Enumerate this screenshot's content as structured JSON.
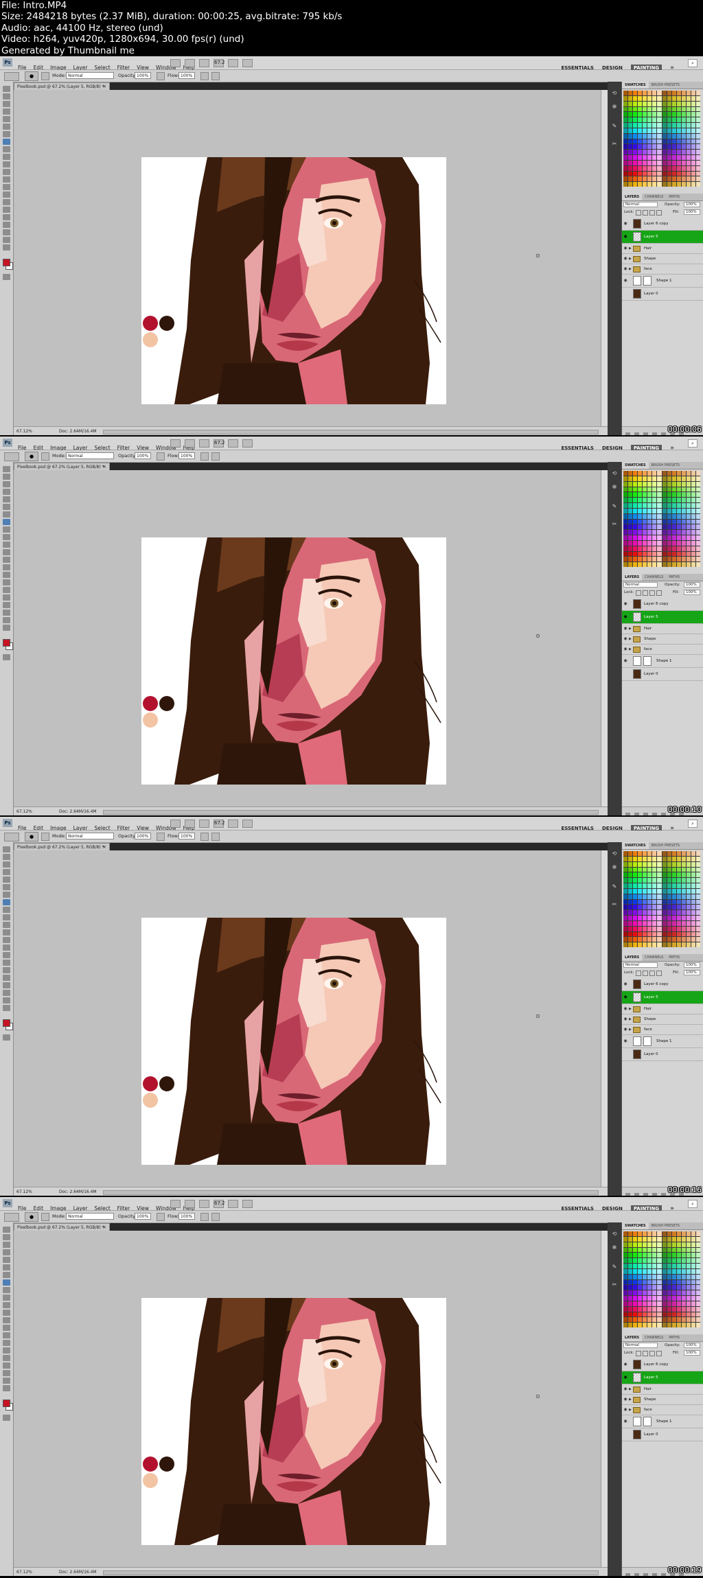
{
  "header": {
    "lines": [
      "File: Intro.MP4",
      "Size: 2484218 bytes (2.37 MiB), duration: 00:00:25, avg.bitrate: 795 kb/s",
      "Audio: aac, 44100 Hz, stereo (und)",
      "Video: h264, yuv420p, 1280x694, 30.00 fps(r) (und)",
      "Generated by Thumbnail me"
    ]
  },
  "app": {
    "logo": "Ps",
    "menus": [
      "File",
      "Edit",
      "Image",
      "Layer",
      "Select",
      "Filter",
      "View",
      "Window",
      "Help"
    ],
    "zoom_select": "67.2",
    "workspaces": [
      "ESSENTIALS",
      "DESIGN",
      "PAINTING"
    ],
    "active_workspace": "PAINTING",
    "more": "»",
    "options": {
      "mode_label": "Mode:",
      "mode_value": "Normal",
      "opacity_label": "Opacity:",
      "opacity_value": "100%",
      "flow_label": "Flow:",
      "flow_value": "100%"
    },
    "doc_tab": "Pixelbook.psd @ 67.2% (Layer 5, RGB/8) *",
    "doc_tab_close": "×",
    "status_zoom": "67.12%",
    "status_doc": "Doc: 2.64M/16.4M",
    "panel_tabs_top": [
      "SWATCHES",
      "BRUSH PRESETS"
    ],
    "panel_tabs_layers": [
      "LAYERS",
      "CHANNELS",
      "PATHS"
    ],
    "layer_mode": "Normal",
    "layer_opacity_label": "Opacity:",
    "layer_opacity": "100%",
    "lock_label": "Lock:",
    "fill_label": "Fill:",
    "fill_value": "100%",
    "layers": [
      {
        "name": "Layer 6 copy",
        "kind": "pixel"
      },
      {
        "name": "Layer 5",
        "kind": "pixel",
        "selected": true
      },
      {
        "name": "Hair",
        "kind": "group"
      },
      {
        "name": "Shape",
        "kind": "group"
      },
      {
        "name": "face",
        "kind": "group"
      },
      {
        "name": "Shape 1",
        "kind": "shape"
      },
      {
        "name": "Layer 0",
        "kind": "pixel"
      }
    ],
    "colors": {
      "selected_layer": "#16a516",
      "swatch_red": "#b3122e",
      "swatch_dark": "#2e160b",
      "swatch_peach": "#f2c4a4"
    }
  },
  "frames": [
    {
      "timestamp": "00:00:06"
    },
    {
      "timestamp": "00:00:10"
    },
    {
      "timestamp": "00:00:16"
    },
    {
      "timestamp": "00:00:19"
    }
  ]
}
